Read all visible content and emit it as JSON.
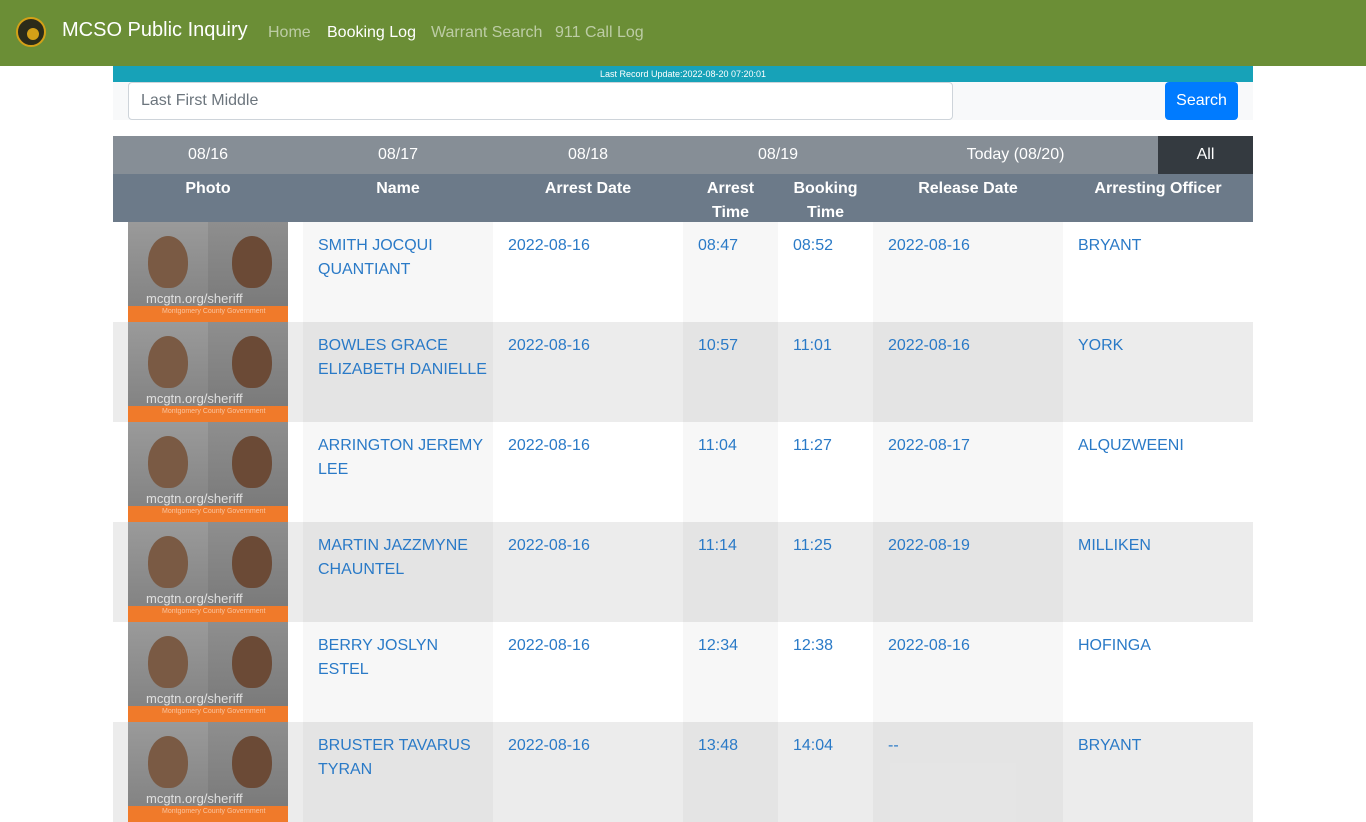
{
  "nav": {
    "brand": "MCSO Public Inquiry",
    "links": [
      "Home",
      "Booking Log",
      "Warrant Search",
      "911 Call Log"
    ],
    "active": "Booking Log"
  },
  "update_text": "Last Record Update:2022-08-20 07:20:01",
  "search": {
    "placeholder": "Last First Middle",
    "button": "Search"
  },
  "date_tabs": [
    "08/16",
    "08/17",
    "08/18",
    "08/19",
    "Today (08/20)",
    "All"
  ],
  "active_tab": "All",
  "columns": {
    "photo": "Photo",
    "name": "Name",
    "arrest_date": "Arrest Date",
    "arrest_time": [
      "Arrest",
      "Time"
    ],
    "booking_time": [
      "Booking",
      "Time"
    ],
    "release_date": "Release Date",
    "officer": "Arresting Officer"
  },
  "photo_watermark": {
    "site": "mcgtn.org/sheriff",
    "org": "Montgomery County Government"
  },
  "rows": [
    {
      "name": [
        "SMITH JOCQUI",
        "QUANTIANT"
      ],
      "arrest_date": "2022-08-16",
      "arrest_time": "08:47",
      "booking_time": "08:52",
      "release_date": "2022-08-16",
      "officer": "BRYANT"
    },
    {
      "name": [
        "BOWLES GRACE",
        "ELIZABETH DANIELLE"
      ],
      "arrest_date": "2022-08-16",
      "arrest_time": "10:57",
      "booking_time": "11:01",
      "release_date": "2022-08-16",
      "officer": "YORK"
    },
    {
      "name": [
        "ARRINGTON JEREMY",
        "LEE"
      ],
      "arrest_date": "2022-08-16",
      "arrest_time": "11:04",
      "booking_time": "11:27",
      "release_date": "2022-08-17",
      "officer": "ALQUZWEENI"
    },
    {
      "name": [
        "MARTIN JAZZMYNE",
        "CHAUNTEL"
      ],
      "arrest_date": "2022-08-16",
      "arrest_time": "11:14",
      "booking_time": "11:25",
      "release_date": "2022-08-19",
      "officer": "MILLIKEN"
    },
    {
      "name": [
        "BERRY JOSLYN ESTEL",
        ""
      ],
      "arrest_date": "2022-08-16",
      "arrest_time": "12:34",
      "booking_time": "12:38",
      "release_date": "2022-08-16",
      "officer": "HOFINGA"
    },
    {
      "name": [
        "BRUSTER TAVARUS",
        "TYRAN"
      ],
      "arrest_date": "2022-08-16",
      "arrest_time": "13:48",
      "booking_time": "14:04",
      "release_date": "--",
      "officer": "BRYANT"
    }
  ],
  "colors": {
    "navbar": "#6b8e36",
    "update_bar": "#17a2b8",
    "link": "#2a7ac7",
    "button": "#007bff"
  }
}
